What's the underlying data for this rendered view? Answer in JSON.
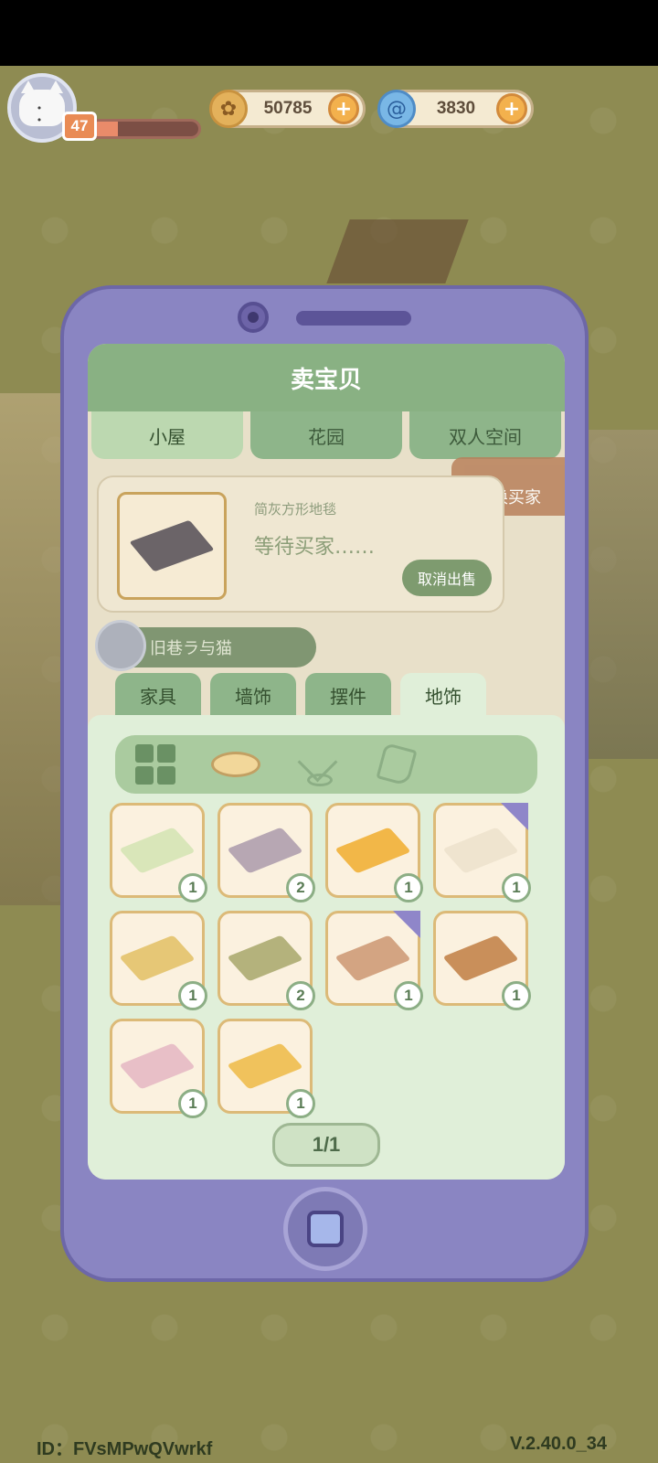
{
  "hud": {
    "level": "47",
    "xp_fraction": 0.25,
    "coins": "50785",
    "gems": "3830",
    "plus": "+"
  },
  "phone": {
    "title": "卖宝贝",
    "top_tabs": [
      "小屋",
      "花园",
      "双人空间"
    ],
    "active_top_tab": 0,
    "sell_item": {
      "name": "简灰方形地毯",
      "status": "等待买家……",
      "cancel_label": "取消出售"
    },
    "call_buyer_label": "呼唤买家",
    "buyer_name": "旧巷ラ与猫",
    "category_tabs": [
      "家具",
      "墙饰",
      "摆件",
      "地饰"
    ],
    "active_category": 3,
    "pager": "1/1",
    "items": [
      {
        "color": "#d9e6b9",
        "count": "1",
        "tag": false
      },
      {
        "color": "#b7a7b3",
        "count": "2",
        "tag": false
      },
      {
        "color": "#f2b748",
        "count": "1",
        "tag": false
      },
      {
        "color": "#efe4cf",
        "count": "1",
        "tag": true
      },
      {
        "color": "#e6c776",
        "count": "1",
        "tag": false
      },
      {
        "color": "#b4b27c",
        "count": "2",
        "tag": false
      },
      {
        "color": "#d3a482",
        "count": "1",
        "tag": true
      },
      {
        "color": "#c98f5a",
        "count": "1",
        "tag": false
      },
      {
        "color": "#e8bfc7",
        "count": "1",
        "tag": false
      },
      {
        "color": "#f0c25c",
        "count": "1",
        "tag": false
      }
    ]
  },
  "footer": {
    "id": "ID：FVsMPwQVwrkf",
    "version": "V.2.40.0_34"
  }
}
